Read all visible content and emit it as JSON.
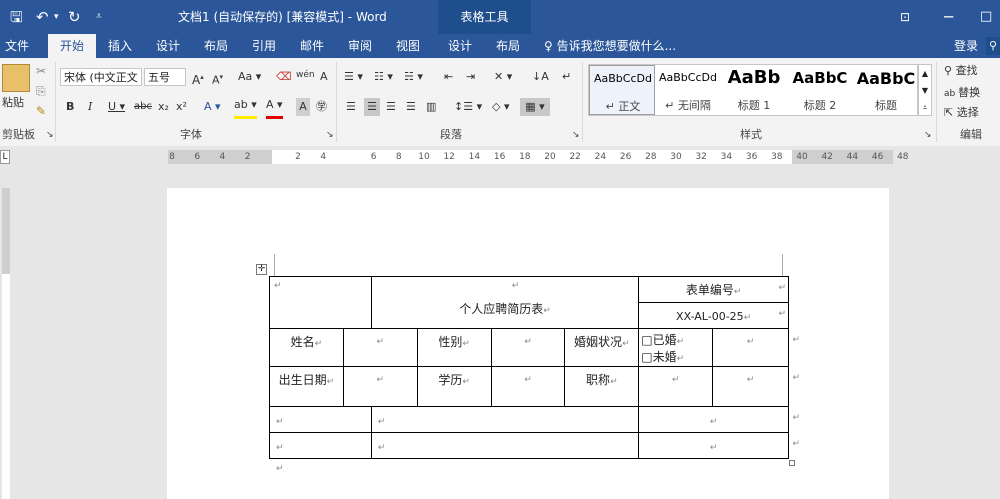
{
  "window": {
    "title": "文档1 (自动保存的) [兼容模式] - Word",
    "context_group": "表格工具"
  },
  "qat": {
    "save_icon": "save-icon",
    "undo_icon": "undo-icon",
    "redo_icon": "redo-icon"
  },
  "tabs": [
    "文件",
    "开始",
    "插入",
    "设计",
    "布局",
    "引用",
    "邮件",
    "审阅",
    "视图",
    "设计",
    "布局"
  ],
  "tell_me": "告诉我您想要做什么...",
  "login": "登录",
  "ribbon": {
    "clipboard": {
      "label": "剪贴板",
      "paste": "粘贴"
    },
    "font": {
      "label": "字体",
      "font_name": "宋体 (中文正文",
      "font_size": "五号",
      "aa": "Aa",
      "wen": "wén"
    },
    "paragraph": {
      "label": "段落"
    },
    "styles": {
      "label": "样式",
      "items": [
        {
          "preview": "AaBbCcDd",
          "name": "↵ 正文"
        },
        {
          "preview": "AaBbCcDd",
          "name": "↵ 无间隔"
        },
        {
          "preview": "AaBb",
          "name": "标题 1"
        },
        {
          "preview": "AaBbC",
          "name": "标题 2"
        },
        {
          "preview": "AaBbC",
          "name": "标题"
        }
      ]
    },
    "editing": {
      "label": "编辑",
      "find": "查找",
      "replace": "替换",
      "select": "选择"
    }
  },
  "ruler": {
    "ticks": [
      "8",
      "6",
      "4",
      "2",
      "",
      "2",
      "4",
      "",
      "6",
      "8",
      "10",
      "12",
      "14",
      "16",
      "18",
      "20",
      "22",
      "24",
      "26",
      "28",
      "30",
      "32",
      "34",
      "36",
      "38",
      "40",
      "42",
      "44",
      "46",
      "48"
    ]
  },
  "table": {
    "title": "个人应聘简历表",
    "form_no_label": "表单编号",
    "form_no": "XX-AL-00-25",
    "name": "姓名",
    "gender": "性别",
    "marital": "婚姻状况",
    "married": "□已婚",
    "unmarried": "□未婚",
    "birth": "出生日期",
    "education": "学历",
    "title_rank": "职称"
  }
}
